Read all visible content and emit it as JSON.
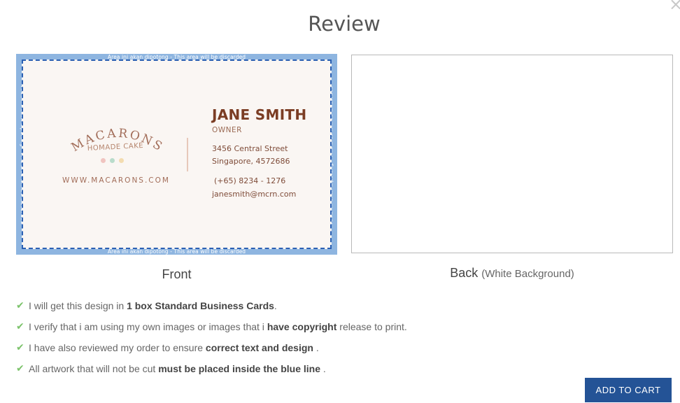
{
  "modal": {
    "title": "Review",
    "close_glyph": "×"
  },
  "front": {
    "bleed_text": "Area ini akan dipotong - This area will be discarded",
    "label": "Front",
    "card": {
      "logo_text": "MACARONS",
      "logo_sub": "HOMADE CAKE",
      "website": "WWW.MACARONS.COM",
      "name": "JANE SMITH",
      "role": "OWNER",
      "address_line1": "3456 Central Street",
      "address_line2": "Singapore, 4572686",
      "phone": "(+65) 8234 - 1276",
      "email": "janesmith@mcrn.com"
    }
  },
  "back": {
    "label": "Back",
    "label_note": "(White Background)"
  },
  "checklist": [
    {
      "pre": "I will get this design in ",
      "bold": "1 box Standard Business Cards",
      "post": "."
    },
    {
      "pre": "I verify that i am using my own images or images that i ",
      "bold": "have copyright",
      "post": " release to print."
    },
    {
      "pre": "I have also reviewed my order to ensure ",
      "bold": "correct text and design",
      "post": " ."
    },
    {
      "pre": "All artwork that will not be cut ",
      "bold": "must be placed inside the blue line",
      "post": " ."
    }
  ],
  "cart_button": "ADD TO CART",
  "colors": {
    "accent": "#245396",
    "cut_line": "#2b60b3",
    "bleed": "#8eb5e0",
    "check": "#7cc36b",
    "card_bg": "#faf6f3",
    "brand_brown": "#7b3d24",
    "dot_pink": "#f0c4c0",
    "dot_mint": "#b9dccb",
    "dot_yellow": "#f3dcb0"
  },
  "icons": [
    "close-icon",
    "checkmark-icon"
  ]
}
